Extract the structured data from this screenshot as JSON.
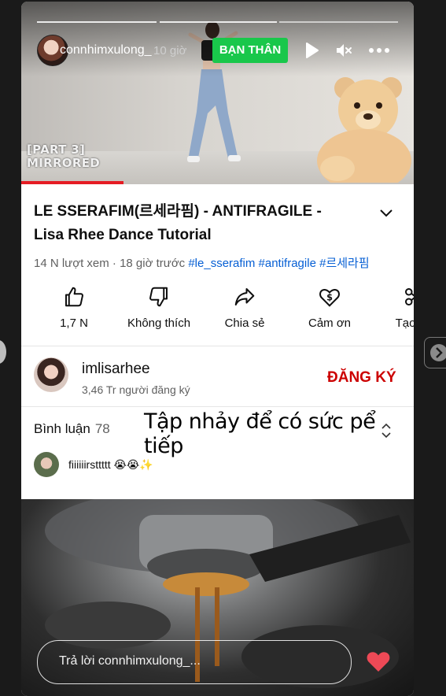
{
  "story": {
    "username": "connhimxulong_",
    "time_ago": "10 giờ",
    "badge": "BẠN THÂN",
    "progress_segments": 3,
    "reply_placeholder": "Trả lời connhimxulong_...",
    "caption": "Tập nhảy để có sức pể tiếp",
    "icons": {
      "play": "play-icon",
      "mute": "mute-icon",
      "more": "more-icon",
      "heart": "heart-icon",
      "next": "chevron-right-icon"
    }
  },
  "video": {
    "overlay_text": "[PART 3]\nMIRRORED",
    "title": "LE SSERAFIM(르세라핌) - ANTIFRAGILE - Lisa Rhee Dance Tutorial",
    "views": "14 N lượt xem",
    "posted": "· 18 giờ trước",
    "tags": "#le_sserafim #antifragile #르세라핌",
    "actions": [
      {
        "label": "1,7 N",
        "icon": "thumbs-up-icon"
      },
      {
        "label": "Không thích",
        "icon": "thumbs-down-icon"
      },
      {
        "label": "Chia sẻ",
        "icon": "share-icon"
      },
      {
        "label": "Cảm ơn",
        "icon": "thanks-icon"
      },
      {
        "label": "Tạo đo",
        "icon": "create-icon"
      }
    ],
    "channel": {
      "name": "imlisarhee",
      "subscribers": "3,46 Tr người đăng ký",
      "subscribe_label": "ĐĂNG KÝ"
    },
    "comments": {
      "label": "Bình luận",
      "count": "78",
      "top_comment": "fiiiiiirsttttt 😭😭✨"
    }
  },
  "colors": {
    "badge": "#19c74b",
    "subscribe": "#cc0000",
    "tags": "#065fd4",
    "heart": "#ed4956",
    "yt_red": "#e51c23"
  }
}
